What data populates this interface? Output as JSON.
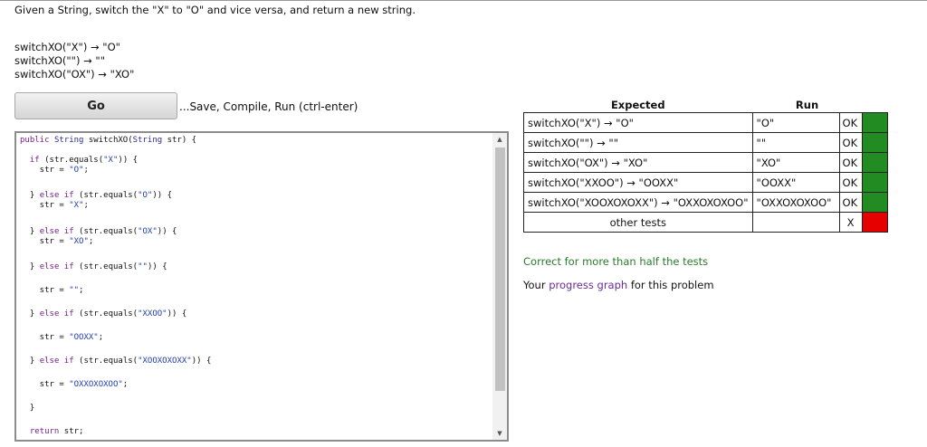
{
  "prompt": "Given a String, switch the \"X\" to \"O\" and vice versa, and return a new string.",
  "examples": [
    "switchXO(\"X\") → \"O\"",
    "switchXO(\"\") → \"\"",
    "switchXO(\"OX\") → \"XO\""
  ],
  "go_label": "Go",
  "go_hint": "...Save, Compile, Run (ctrl-enter)",
  "code_lines": [
    "public String switchXO(String str) {",
    "",
    "  if (str.equals(\"X\")) {",
    "    str = \"O\";",
    "",
    "  } else if (str.equals(\"O\")) {",
    "    str = \"X\";",
    "",
    "  } else if (str.equals(\"OX\")) {",
    "    str = \"XO\";",
    "",
    "  } else if (str.equals(\"\")) {",
    "",
    "    str = \"\";",
    "",
    "  } else if (str.equals(\"XXOO\")) {",
    "",
    "    str = \"OOXX\";",
    "",
    "  } else if (str.equals(\"XOOXOXOXX\")) {",
    "",
    "    str = \"OXXOXOXOO\";",
    "",
    "  }",
    "",
    "  return str;"
  ],
  "table": {
    "header_expected": "Expected",
    "header_run": "Run",
    "rows": [
      {
        "expected": "switchXO(\"X\") → \"O\"",
        "run": "\"O\"",
        "status": "OK",
        "result": "pass"
      },
      {
        "expected": "switchXO(\"\") → \"\"",
        "run": "\"\"",
        "status": "OK",
        "result": "pass"
      },
      {
        "expected": "switchXO(\"OX\") → \"XO\"",
        "run": "\"XO\"",
        "status": "OK",
        "result": "pass"
      },
      {
        "expected": "switchXO(\"XXOO\") → \"OOXX\"",
        "run": "\"OOXX\"",
        "status": "OK",
        "result": "pass"
      },
      {
        "expected": "switchXO(\"XOOXOXOXX\") → \"OXXOXOXOO\"",
        "run": "\"OXXOXOXOO\"",
        "status": "OK",
        "result": "pass"
      }
    ],
    "other": {
      "label": "other tests",
      "run": "",
      "status": "X",
      "result": "fail"
    }
  },
  "colors": {
    "pass": "#228b22",
    "fail": "#e60000",
    "summary": "#2a7a2a",
    "link": "#6b2a99"
  },
  "summary": "Correct for more than half the tests",
  "progress": {
    "prefix": "Your ",
    "link": "progress graph",
    "suffix": " for this problem"
  }
}
